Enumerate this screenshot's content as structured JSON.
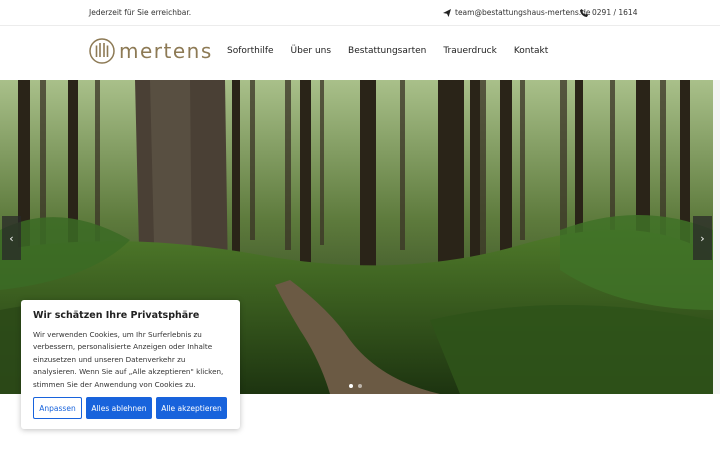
{
  "topbar": {
    "tagline": "Jederzeit für Sie erreichbar.",
    "email": "team@bestattungshaus-mertens.de",
    "phone": "0291 / 1614"
  },
  "header": {
    "logo_text": "mertens",
    "nav": [
      "Soforthilfe",
      "Über uns",
      "Bestattungsarten",
      "Trauerdruck",
      "Kontakt"
    ]
  },
  "slider": {
    "prev_icon": "chevron-left-icon",
    "next_icon": "chevron-right-icon",
    "prev_glyph": "‹",
    "next_glyph": "›",
    "slide_count": 2,
    "active_slide": 1
  },
  "cookie": {
    "title": "Wir schätzen Ihre Privatsphäre",
    "text": "Wir verwenden Cookies, um Ihr Surferlebnis zu verbessern, personalisierte Anzeigen oder Inhalte einzusetzen und unseren Datenverkehr zu analysieren. Wenn Sie auf „Alle akzeptieren\" klicken, stimmen Sie der Anwendung von Cookies zu.",
    "customize_label": "Anpassen",
    "reject_label": "Alles ablehnen",
    "accept_label": "Alle akzeptieren"
  },
  "colors": {
    "brand_gold": "#8d7a55",
    "button_blue": "#1863dc"
  }
}
